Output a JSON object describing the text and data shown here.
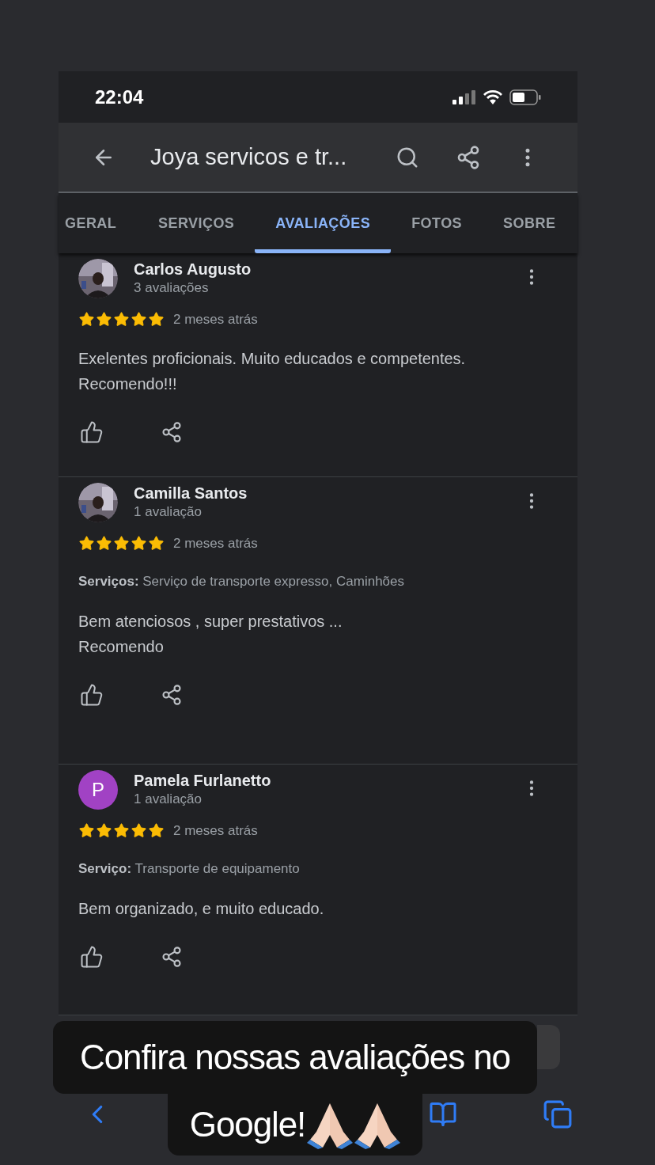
{
  "status_bar": {
    "time": "22:04"
  },
  "header": {
    "title": "Joya servicos e tr..."
  },
  "tabs": [
    {
      "label": "GERAL",
      "selected": false
    },
    {
      "label": "SERVIÇOS",
      "selected": false
    },
    {
      "label": "AVALIAÇÕES",
      "selected": true
    },
    {
      "label": "FOTOS",
      "selected": false
    },
    {
      "label": "SOBRE",
      "selected": false
    }
  ],
  "reviews": [
    {
      "name": "Carlos Augusto",
      "count": "3 avaliações",
      "stars": 5,
      "time": "2 meses atrás",
      "text": "Exelentes proficionais. Muito educados e competentes.\nRecomendo!!!"
    },
    {
      "name": "Camilla Santos",
      "count": "1 avaliação",
      "stars": 5,
      "time": "2 meses atrás",
      "service": "**Serviços:** Serviço de transporte expresso, Caminhões",
      "text": "Bem atenciosos , super prestativos ...\nRecomendo"
    },
    {
      "name": "Pamela Furlanetto",
      "count": "1 avaliação",
      "avatar": {
        "kind": "letter",
        "letter": "P",
        "color": "#a142c4"
      },
      "stars": 5,
      "time": "2 meses atrás",
      "service": "**Serviço:** Transporte de equipamento",
      "text": "Bem organizado, e muito educado."
    }
  ],
  "caption": {
    "lines": [
      "Confira nossas avaliações no",
      "Google!"
    ]
  }
}
